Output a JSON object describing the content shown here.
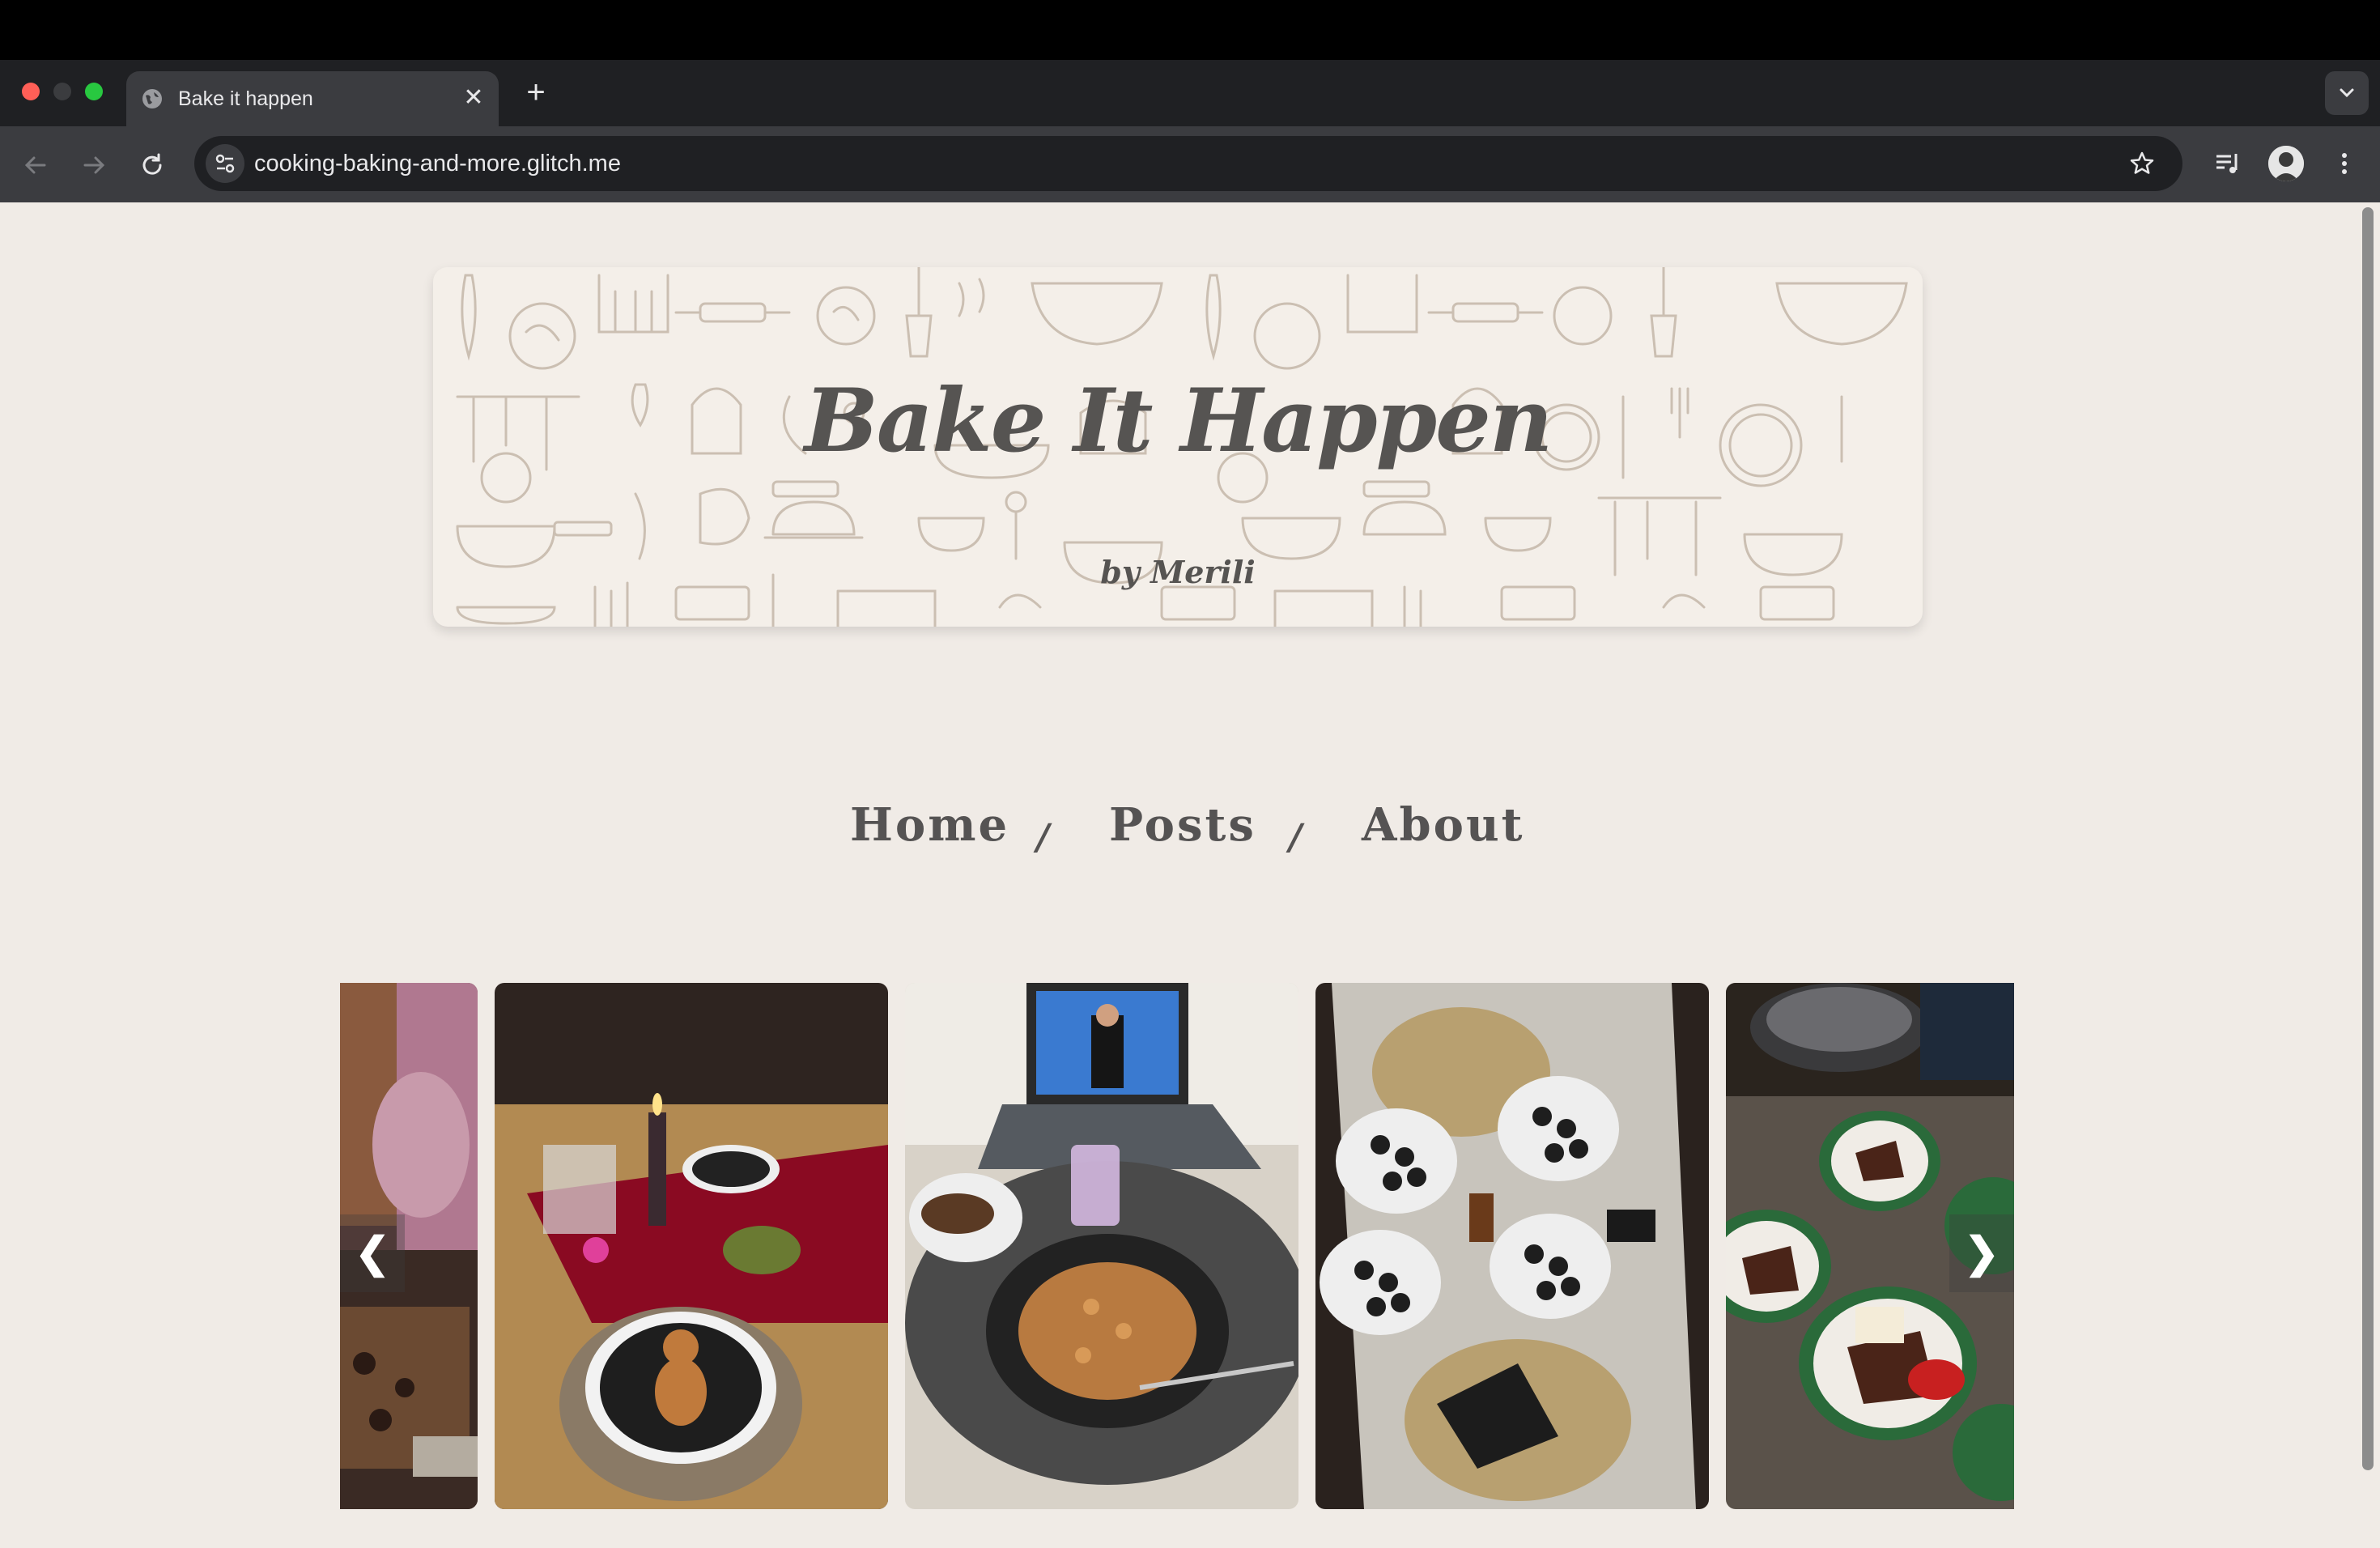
{
  "browser": {
    "tab_title": "Bake it happen",
    "url": "cooking-baking-and-more.glitch.me",
    "new_tab_label": "+",
    "close_tab_label": "✕"
  },
  "banner": {
    "title": "Bake It Happen",
    "subtitle": "by Merili"
  },
  "nav": {
    "items": [
      "Home",
      "Posts",
      "About"
    ],
    "separator": "/"
  },
  "carousel": {
    "prev_label": "❮",
    "next_label": "❯",
    "slides": [
      {
        "id": "slide-gingerbread-box"
      },
      {
        "id": "slide-gingerbread-table"
      },
      {
        "id": "slide-pasta-laptop"
      },
      {
        "id": "slide-sushi-table"
      },
      {
        "id": "slide-cake-plates"
      }
    ]
  },
  "colors": {
    "page_bg": "#f0ebe6",
    "text": "#555353",
    "chrome_dark": "#1f2023",
    "chrome_mid": "#3b3c40"
  }
}
